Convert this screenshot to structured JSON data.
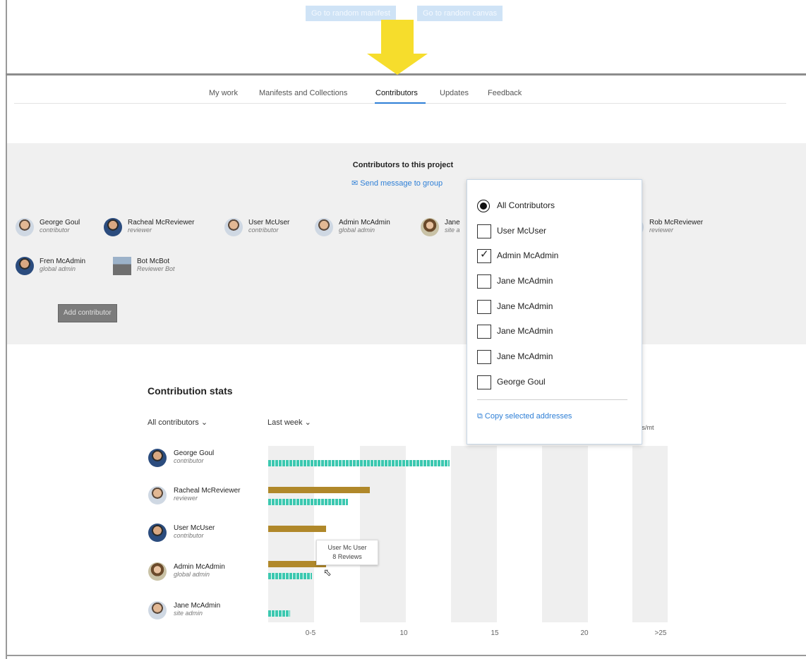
{
  "top_buttons": {
    "random_manifest": "Go to random manifest",
    "random_canvas": "Go to random canvas"
  },
  "nav": {
    "tabs": [
      "My work",
      "Manifests and Collections",
      "Contributors",
      "Updates",
      "Feedback"
    ],
    "active": "Contributors"
  },
  "contributors_panel": {
    "title": "Contributors to this project",
    "send_message": "Send message to group",
    "add_button": "Add contributor",
    "people": [
      {
        "name": "George Goul",
        "role": "contributor"
      },
      {
        "name": "Racheal McReviewer",
        "role": "reviewer"
      },
      {
        "name": "User McUser",
        "role": "contributor"
      },
      {
        "name": "Admin McAdmin",
        "role": "global admin"
      },
      {
        "name": "Jane",
        "role": "site a"
      },
      {
        "name": "Rob McReviewer",
        "role": "reviewer"
      },
      {
        "name": "Fren McAdmin",
        "role": "global admin"
      },
      {
        "name": "Bot McBot",
        "role": "Reviewer Bot"
      }
    ]
  },
  "recipient_dropdown": {
    "options": [
      {
        "label": "All Contributors",
        "type": "radio",
        "selected": true
      },
      {
        "label": "User McUser",
        "type": "checkbox",
        "checked": false
      },
      {
        "label": "Admin McAdmin",
        "type": "checkbox",
        "checked": true
      },
      {
        "label": "Jane McAdmin",
        "type": "checkbox",
        "checked": false
      },
      {
        "label": "Jane McAdmin",
        "type": "checkbox",
        "checked": false
      },
      {
        "label": "Jane McAdmin",
        "type": "checkbox",
        "checked": false
      },
      {
        "label": "Jane McAdmin",
        "type": "checkbox",
        "checked": false
      },
      {
        "label": "George Goul",
        "type": "checkbox",
        "checked": false
      }
    ],
    "copy_action": "Copy selected addresses"
  },
  "stats": {
    "title": "Contribution stats",
    "filter_contributors": "All contributors",
    "filter_period": "Last week",
    "partial_label": "ws/mt",
    "tooltip": {
      "line1": "User Mc User",
      "line2": "8 Reviews"
    },
    "rows": [
      {
        "name": "George Goul",
        "role": "contributor"
      },
      {
        "name": "Racheal McReviewer",
        "role": "reviewer"
      },
      {
        "name": "User McUser",
        "role": "contributor"
      },
      {
        "name": "Admin McAdmin",
        "role": "global admin"
      },
      {
        "name": "Jane McAdmin",
        "role": "site admin"
      }
    ]
  },
  "chart_data": {
    "type": "bar",
    "categories": [
      "George Goul",
      "Racheal McReviewer",
      "User McUser",
      "Admin McAdmin",
      "Jane McAdmin"
    ],
    "tick_labels": [
      "0-5",
      "10",
      "15",
      "20",
      ">25"
    ],
    "series": [
      {
        "color": "#b0882a",
        "values": [
          0,
          14,
          8,
          8,
          0
        ]
      },
      {
        "color": "#3cc8b0",
        "values": [
          25,
          11,
          0,
          6,
          3
        ]
      }
    ],
    "xlim": [
      0,
      55
    ]
  }
}
